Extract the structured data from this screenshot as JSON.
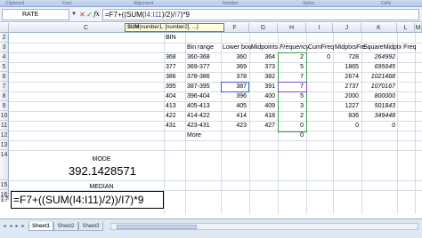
{
  "ribbon": {
    "groups": [
      "Clipboard",
      "Font",
      "Alignment",
      "Number",
      "Styles",
      "Cells"
    ]
  },
  "formula_bar": {
    "name_box": "RATE",
    "cancel_icon": "✕",
    "enter_icon": "✓",
    "fx_label": "fx",
    "formula_prefix": "=F7+((SUM(",
    "formula_ref": "I4:I11",
    "formula_mid": ")/2)/",
    "formula_ref2": "I7",
    "formula_suffix": ")*9"
  },
  "tooltip": {
    "func": "SUM",
    "args": "(number1, [number2], ...)"
  },
  "columns": {
    "visible": [
      "C",
      "D",
      "E",
      "F",
      "G",
      "H",
      "I",
      "J",
      "K",
      "L",
      "M"
    ]
  },
  "rows": {
    "numbers": [
      "2",
      "3",
      "4",
      "5",
      "6",
      "7",
      "8",
      "9",
      "10",
      "11",
      "12",
      "13",
      "14",
      "15",
      "16"
    ]
  },
  "sheet": {
    "d2": "BIN",
    "headers": {
      "e3": "Bin range",
      "f3": "Lower bou",
      "g3": "Midpoints",
      "h3": "Frequency",
      "i3": "CumFreq",
      "j3": "MidptxsFre",
      "k3": "SquareMidptx Freq"
    },
    "d_col": [
      "368",
      "377",
      "386",
      "395",
      "404",
      "413",
      "422",
      "431"
    ],
    "e_col": [
      "360-368",
      "369-377",
      "378-386",
      "387-395",
      "396-404",
      "405-413",
      "414-422",
      "423-431",
      "More"
    ],
    "f_col": [
      "360",
      "369",
      "378",
      "387",
      "396",
      "405",
      "414",
      "423"
    ],
    "g_col": [
      "364",
      "373",
      "382",
      "391",
      "400",
      "409",
      "418",
      "427"
    ],
    "h_col": [
      "2",
      "5",
      "7",
      "7",
      "5",
      "3",
      "2",
      "0",
      "0"
    ],
    "i_col": [
      "0",
      "",
      "",
      "",
      "",
      "",
      "",
      ""
    ],
    "j_col": [
      "728",
      "1865",
      "2674",
      "2737",
      "2000",
      "1227",
      "836",
      "0"
    ],
    "k_col": [
      "264992",
      "695645",
      "1021468",
      "1070167",
      "800000",
      "501843",
      "349448",
      "0"
    ]
  },
  "summary": {
    "mode_label": "MODE",
    "mode_value": "392.1428571",
    "median_label": "MEDIAN",
    "median_formula": "=F7+((SUM(I4:I11)/2))/I7)*9",
    "row17": "17"
  },
  "tabs": {
    "sheets": [
      "Sheet1",
      "Sheet2",
      "Sheet3"
    ],
    "active": "Sheet1"
  }
}
